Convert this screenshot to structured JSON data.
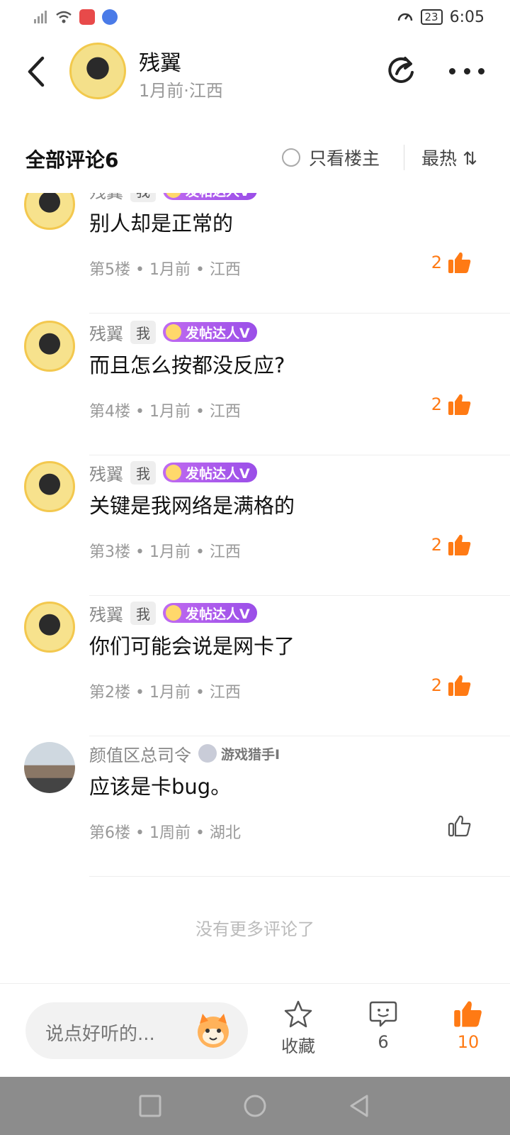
{
  "status_bar": {
    "time": "6:05",
    "battery": "23"
  },
  "header": {
    "author_name": "残翼",
    "author_meta": "1月前·江西"
  },
  "comments_header": {
    "title": "全部评论6",
    "owner_only": "只看楼主",
    "sort": "最热 ⇅"
  },
  "comments": [
    {
      "name": "残翼",
      "me_tag": "我",
      "badge": "发帖达人V",
      "text": "别人却是正常的",
      "meta": "第5楼 • 1月前 • 江西",
      "likes": "2",
      "liked": true
    },
    {
      "name": "残翼",
      "me_tag": "我",
      "badge": "发帖达人V",
      "text": "而且怎么按都没反应?",
      "meta": "第4楼 • 1月前 • 江西",
      "likes": "2",
      "liked": true
    },
    {
      "name": "残翼",
      "me_tag": "我",
      "badge": "发帖达人V",
      "text": "关键是我网络是满格的",
      "meta": "第3楼 • 1月前 • 江西",
      "likes": "2",
      "liked": true
    },
    {
      "name": "残翼",
      "me_tag": "我",
      "badge": "发帖达人V",
      "text": "你们可能会说是网卡了",
      "meta": "第2楼 • 1月前 • 江西",
      "likes": "2",
      "liked": true
    },
    {
      "name": "颜值区总司令",
      "badge": "游戏猎手I",
      "text": "应该是卡bug。",
      "meta": "第6楼 • 1周前 • 湖北",
      "likes": "",
      "liked": false
    }
  ],
  "no_more": "没有更多评论了",
  "bottom_bar": {
    "comment_placeholder": "说点好听的...",
    "collect_label": "收藏",
    "comment_count": "6",
    "like_count": "10"
  },
  "colors": {
    "accent": "#ff7a14",
    "badge_purple": "#a654ea"
  }
}
